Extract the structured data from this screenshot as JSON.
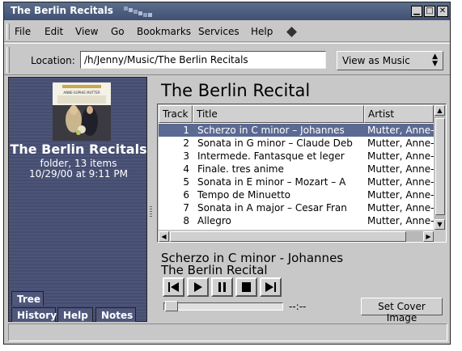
{
  "window": {
    "title": "The Berlin Recitals",
    "controls": {
      "minimize": "▁",
      "maximize": "□",
      "close": "✕"
    }
  },
  "menubar": {
    "items": [
      "File",
      "Edit",
      "View",
      "Go",
      "Bookmarks",
      "Services",
      "Help"
    ]
  },
  "location": {
    "label": "Location:",
    "value": "/h/Jenny/Music/The Berlin Recitals",
    "view_as": "View as Music"
  },
  "sidebar": {
    "title": "The Berlin Recitals",
    "info_line1": "folder, 13 items",
    "info_line2": "10/29/00 at 9:11 PM",
    "album_art_text": "ANNE-SOPHIE MUTTER",
    "tabs": [
      "Tree",
      "History",
      "Help",
      "Notes"
    ]
  },
  "main": {
    "title": "The Berlin Recital",
    "columns": [
      "Track",
      "Title",
      "Artist"
    ],
    "tracks": [
      {
        "num": "1",
        "title": "Scherzo in C minor – Johannes",
        "artist": "Mutter, Anne-"
      },
      {
        "num": "2",
        "title": "Sonata in G minor – Claude Deb",
        "artist": "Mutter, Anne-"
      },
      {
        "num": "3",
        "title": "Intermede. Fantasque et leger",
        "artist": "Mutter, Anne-"
      },
      {
        "num": "4",
        "title": "Finale. tres anime",
        "artist": "Mutter, Anne-"
      },
      {
        "num": "5",
        "title": "Sonata in E minor – Mozart – A",
        "artist": "Mutter, Anne-"
      },
      {
        "num": "6",
        "title": "Tempo de Minuetto",
        "artist": "Mutter, Anne-"
      },
      {
        "num": "7",
        "title": "Sonata in A major – Cesar Fran",
        "artist": "Mutter, Anne-"
      },
      {
        "num": "8",
        "title": "Allegro",
        "artist": "Mutter, Anne-"
      }
    ],
    "selected_index": 0,
    "now_playing_track": "Scherzo in C minor - Johannes",
    "now_playing_album": "The Berlin Recital",
    "time": "--:--",
    "cover_button": "Set Cover Image",
    "playback_progress": 0.0
  },
  "colors": {
    "selection": "#5b6a92",
    "sidebar_bg": "#4c5478",
    "titlebar": "#4a5a7c"
  }
}
